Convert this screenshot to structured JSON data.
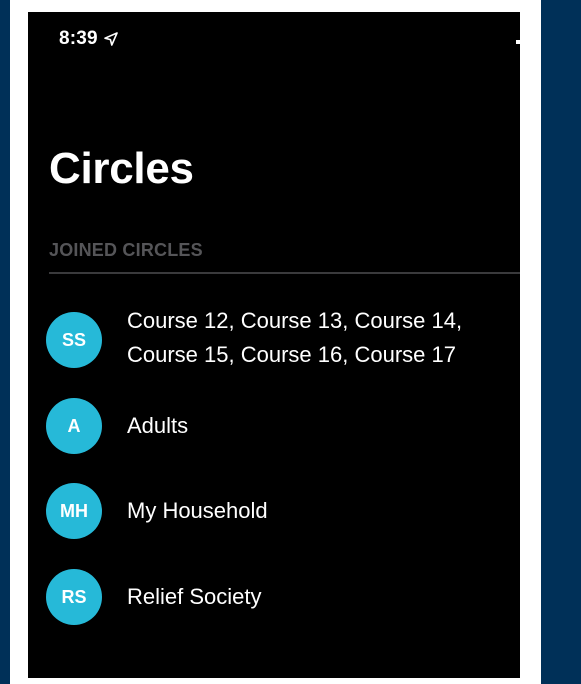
{
  "status_bar": {
    "time": "8:39",
    "location_icon": "location-arrow-icon"
  },
  "page": {
    "title": "Circles"
  },
  "section": {
    "header": "JOINED CIRCLES"
  },
  "circles": [
    {
      "initials": "SS",
      "name_lines": [
        "Course 12, Course 13, Course 14,",
        "Course 15, Course 16, Course 17"
      ]
    },
    {
      "initials": "A",
      "name_lines": [
        "Adults"
      ]
    },
    {
      "initials": "MH",
      "name_lines": [
        "My Household"
      ]
    },
    {
      "initials": "RS",
      "name_lines": [
        "Relief Society"
      ]
    }
  ],
  "colors": {
    "background": "#000000",
    "avatar": "#26b9d8",
    "frame_accent": "#003058",
    "section_header": "#555558"
  }
}
